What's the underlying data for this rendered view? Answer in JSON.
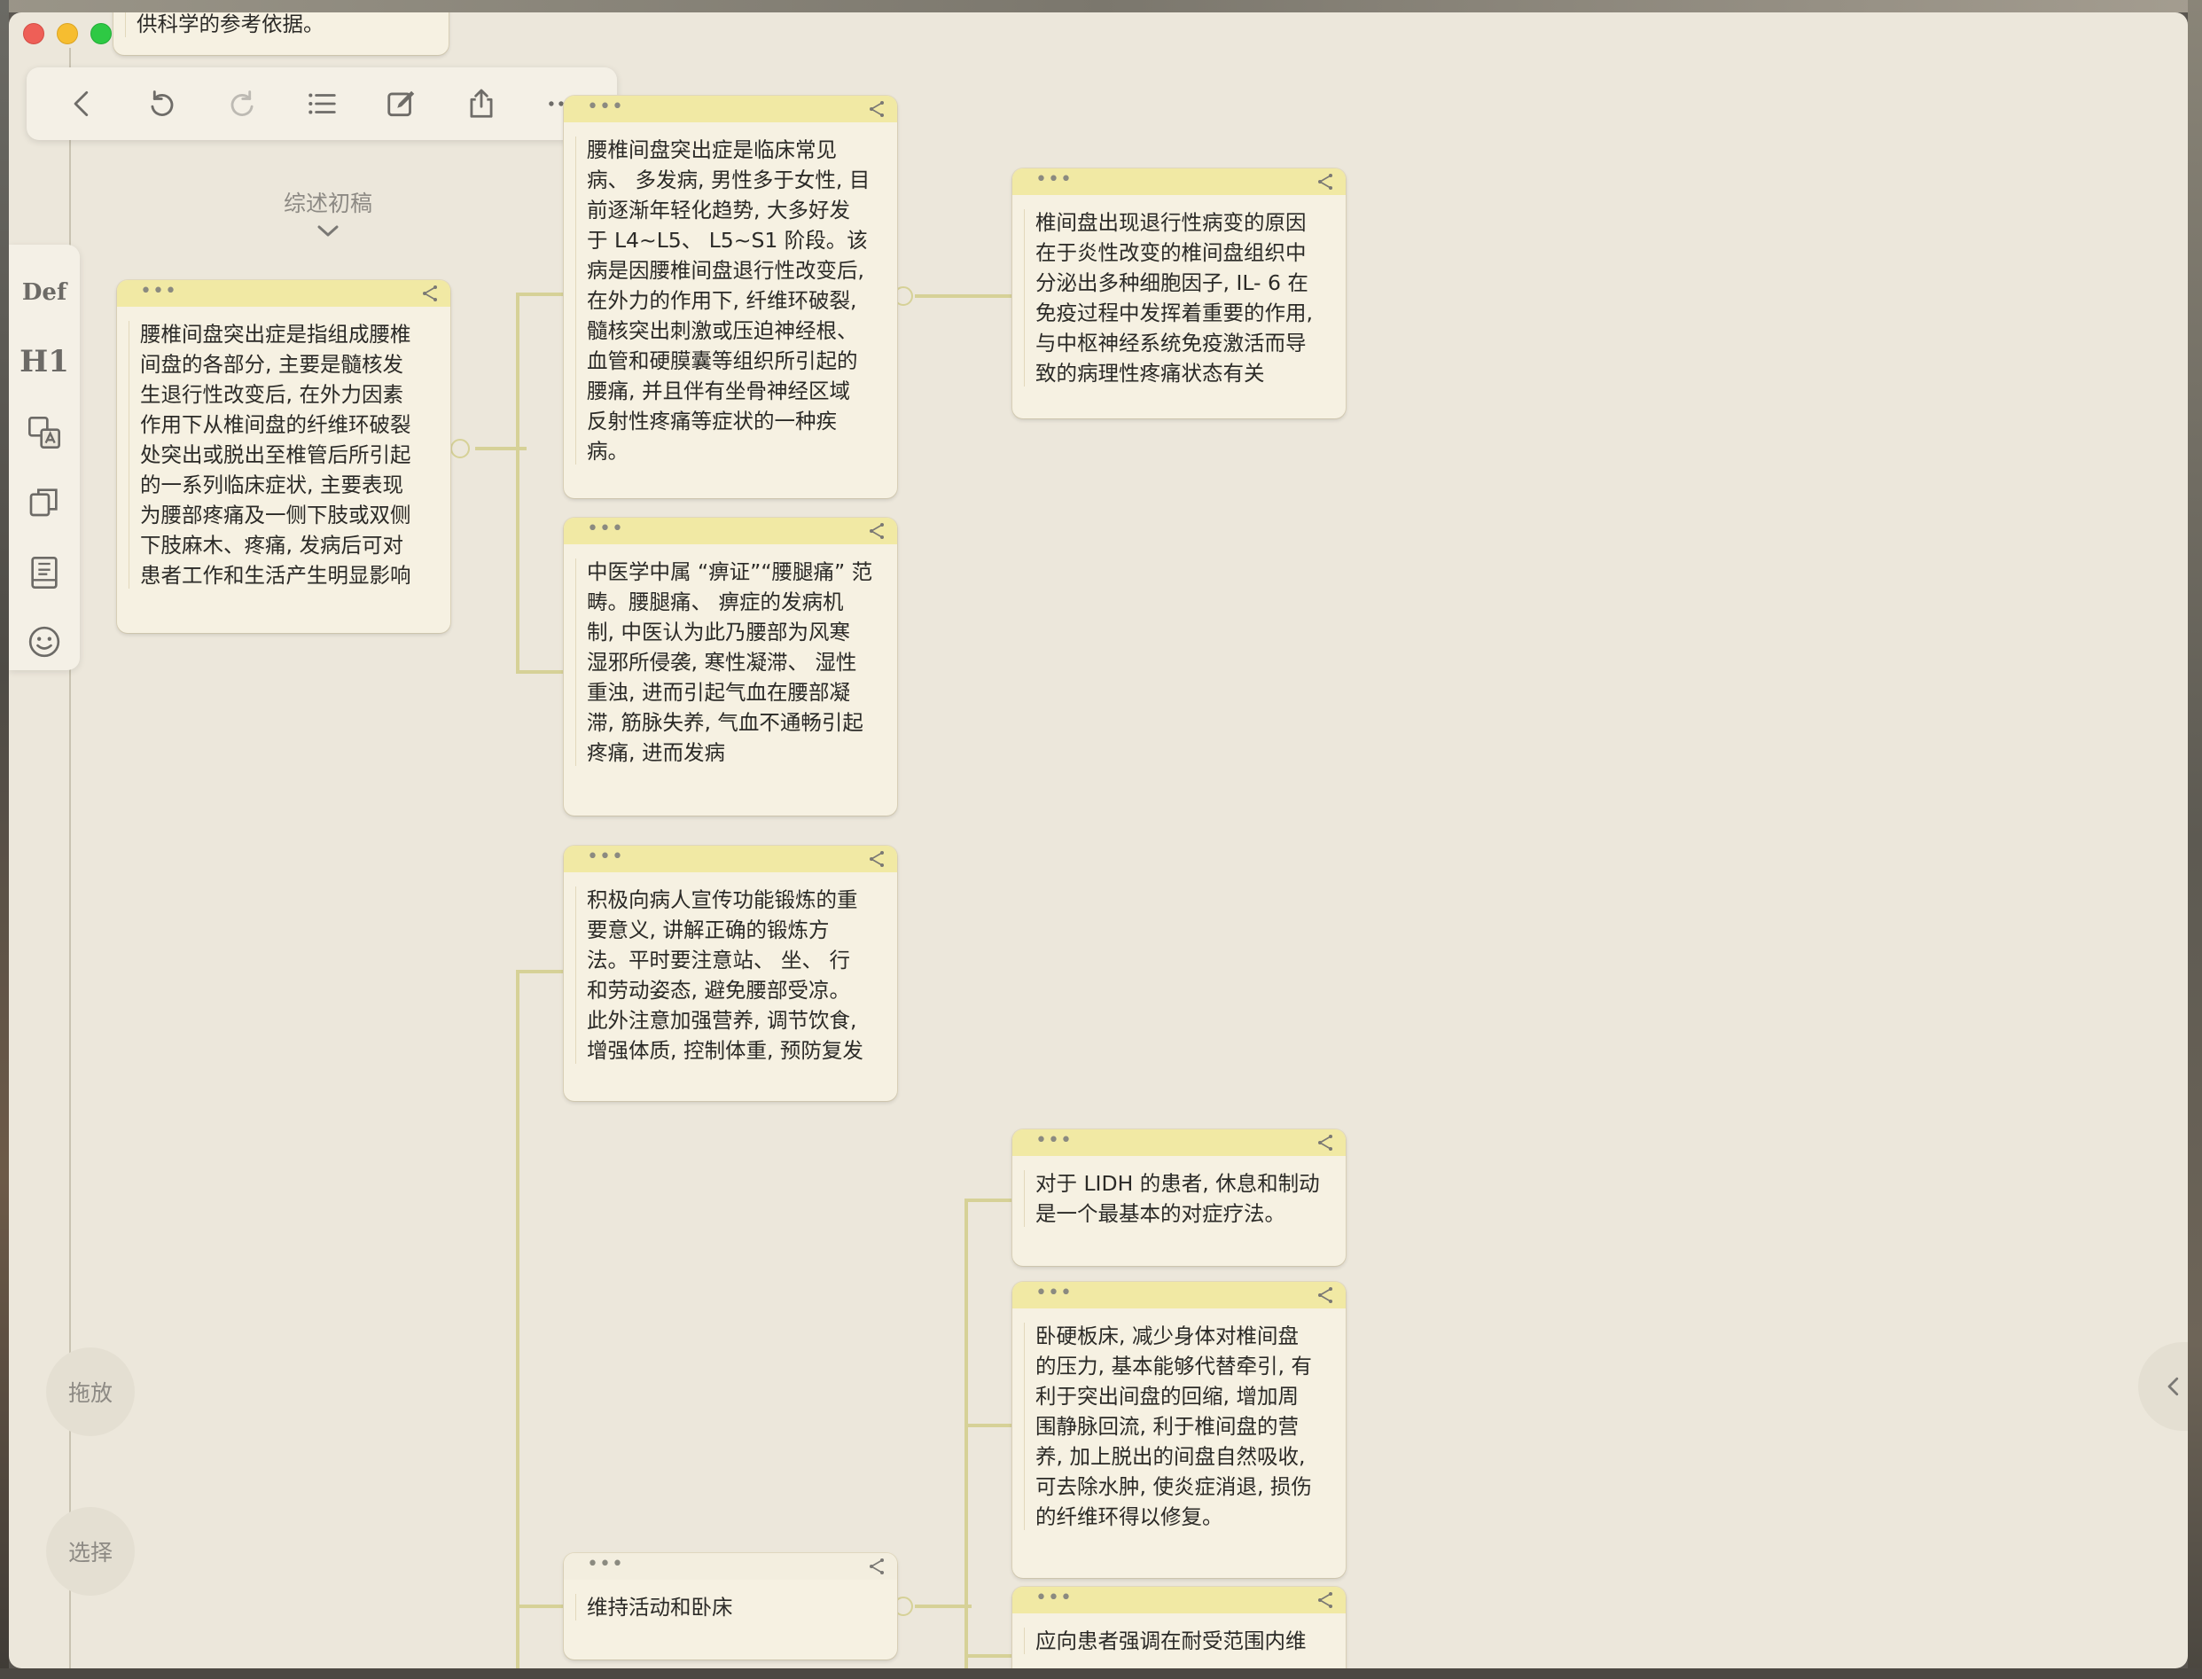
{
  "window": {
    "title": ""
  },
  "toolbar": {
    "items": [
      {
        "icon": "back-icon"
      },
      {
        "icon": "undo-icon"
      },
      {
        "icon": "redo-icon"
      },
      {
        "icon": "list-icon"
      },
      {
        "icon": "edit-icon"
      },
      {
        "icon": "share-icon"
      },
      {
        "icon": "more-icon"
      }
    ]
  },
  "sidebar": {
    "def_label": "Def",
    "h1_label": "H1",
    "items": [
      {
        "icon": "translate-icon"
      },
      {
        "icon": "copy-icon"
      },
      {
        "icon": "dictionary-icon"
      },
      {
        "icon": "emoji-icon"
      }
    ]
  },
  "root": {
    "heading": "综述初稿"
  },
  "buttons": {
    "drag": "拖放",
    "select": "选择"
  },
  "cards": {
    "top_partial": "供科学的参考依据。",
    "definition": "腰椎间盘突出症是指组成腰椎\n间盘的各部分, 主要是髓核发\n生退行性改变后, 在外力因素\n作用下从椎间盘的纤维环破裂\n处突出或脱出至椎管后所引起\n的一系列临床症状, 主要表现\n为腰部疼痛及一侧下肢或双侧\n下肢麻木、疼痛, 发病后可对\n患者工作和生活产生明显影响",
    "epidemiology": "腰椎间盘突出症是临床常见\n病、 多发病, 男性多于女性, 目\n前逐渐年轻化趋势, 大多好发\n于 L4~L5、 L5~S1 阶段。该\n病是因腰椎间盘退行性改变后,\n在外力的作用下, 纤维环破裂,\n髓核突出刺激或压迫神经根、\n血管和硬膜囊等组织所引起的\n腰痛, 并且伴有坐骨神经区域\n反射性疼痛等症状的一种疾\n病。",
    "cause": "椎间盘出现退行性病变的原因\n在于炎性改变的椎间盘组织中\n分泌出多种细胞因子, IL- 6 在\n免疫过程中发挥着重要的作用,\n与中枢神经系统免疫激活而导\n致的病理性疼痛状态有关",
    "tcm": "中医学中属 “痹证”“腰腿痛” 范\n畴。腰腿痛、 痹症的发病机\n制, 中医认为此乃腰部为风寒\n湿邪所侵袭, 寒性凝滞、 湿性\n重浊, 进而引起气血在腰部凝\n滞, 筋脉失养, 气血不通畅引起\n疼痛, 进而发病",
    "exercise": "积极向病人宣传功能锻炼的重\n要意义, 讲解正确的锻炼方\n法。平时要注意站、 坐、 行\n和劳动姿态, 避免腰部受凉。\n此外注意加强营养, 调节饮食,\n增强体质, 控制体重, 预防复发",
    "rest_basic": "对于 LIDH 的患者, 休息和制动\n是一个最基本的对症疗法。",
    "hard_bed": "卧硬板床, 减少身体对椎间盘\n的压力, 基本能够代替牵引, 有\n利于突出间盘的回缩, 增加周\n围静脉回流, 利于椎间盘的营\n养, 加上脱出的间盘自然吸收,\n可去除水肿, 使炎症消退, 损伤\n的纤维环得以修复。",
    "activity_bed": "维持活动和卧床",
    "tolerance": "应向患者强调在耐受范围内维"
  },
  "colors": {
    "card_header": "#f1e9a4",
    "card_body": "#f6f1e2",
    "connector": "#d6d197",
    "canvas": "#ece7db"
  }
}
